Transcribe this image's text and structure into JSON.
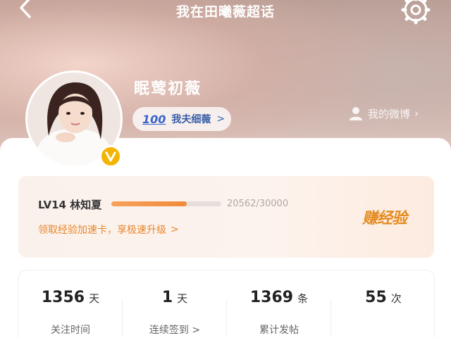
{
  "header": {
    "title": "我在田曦薇超话",
    "icons": {
      "back": "chevron-left-icon",
      "settings": "gear-icon"
    }
  },
  "profile": {
    "username": "眠莺初薇",
    "fan_badge_emoji": "100",
    "fan_badge_label": "我夫细薇",
    "fan_badge_chevron": ">",
    "my_weibo_label": "我的微博",
    "verified_icon": "verified-badge-icon",
    "verified_color": "#f4b400"
  },
  "level": {
    "level_text": "LV14 林知夏",
    "progress_current": 20562,
    "progress_total": 30000,
    "progress_label": "20562/30000",
    "speed_link": "领取经验加速卡，享极速升级",
    "speed_chevron": ">",
    "earn_button": "赚经验",
    "accent_color": "#e48a1d"
  },
  "stats": [
    {
      "value": "1356",
      "unit": "天",
      "label": "关注时间"
    },
    {
      "value": "1",
      "unit": "天",
      "label": "连续签到 >"
    },
    {
      "value": "1369",
      "unit": "条",
      "label": "累计发帖"
    },
    {
      "value": "55",
      "unit": "次",
      "label": ""
    }
  ]
}
